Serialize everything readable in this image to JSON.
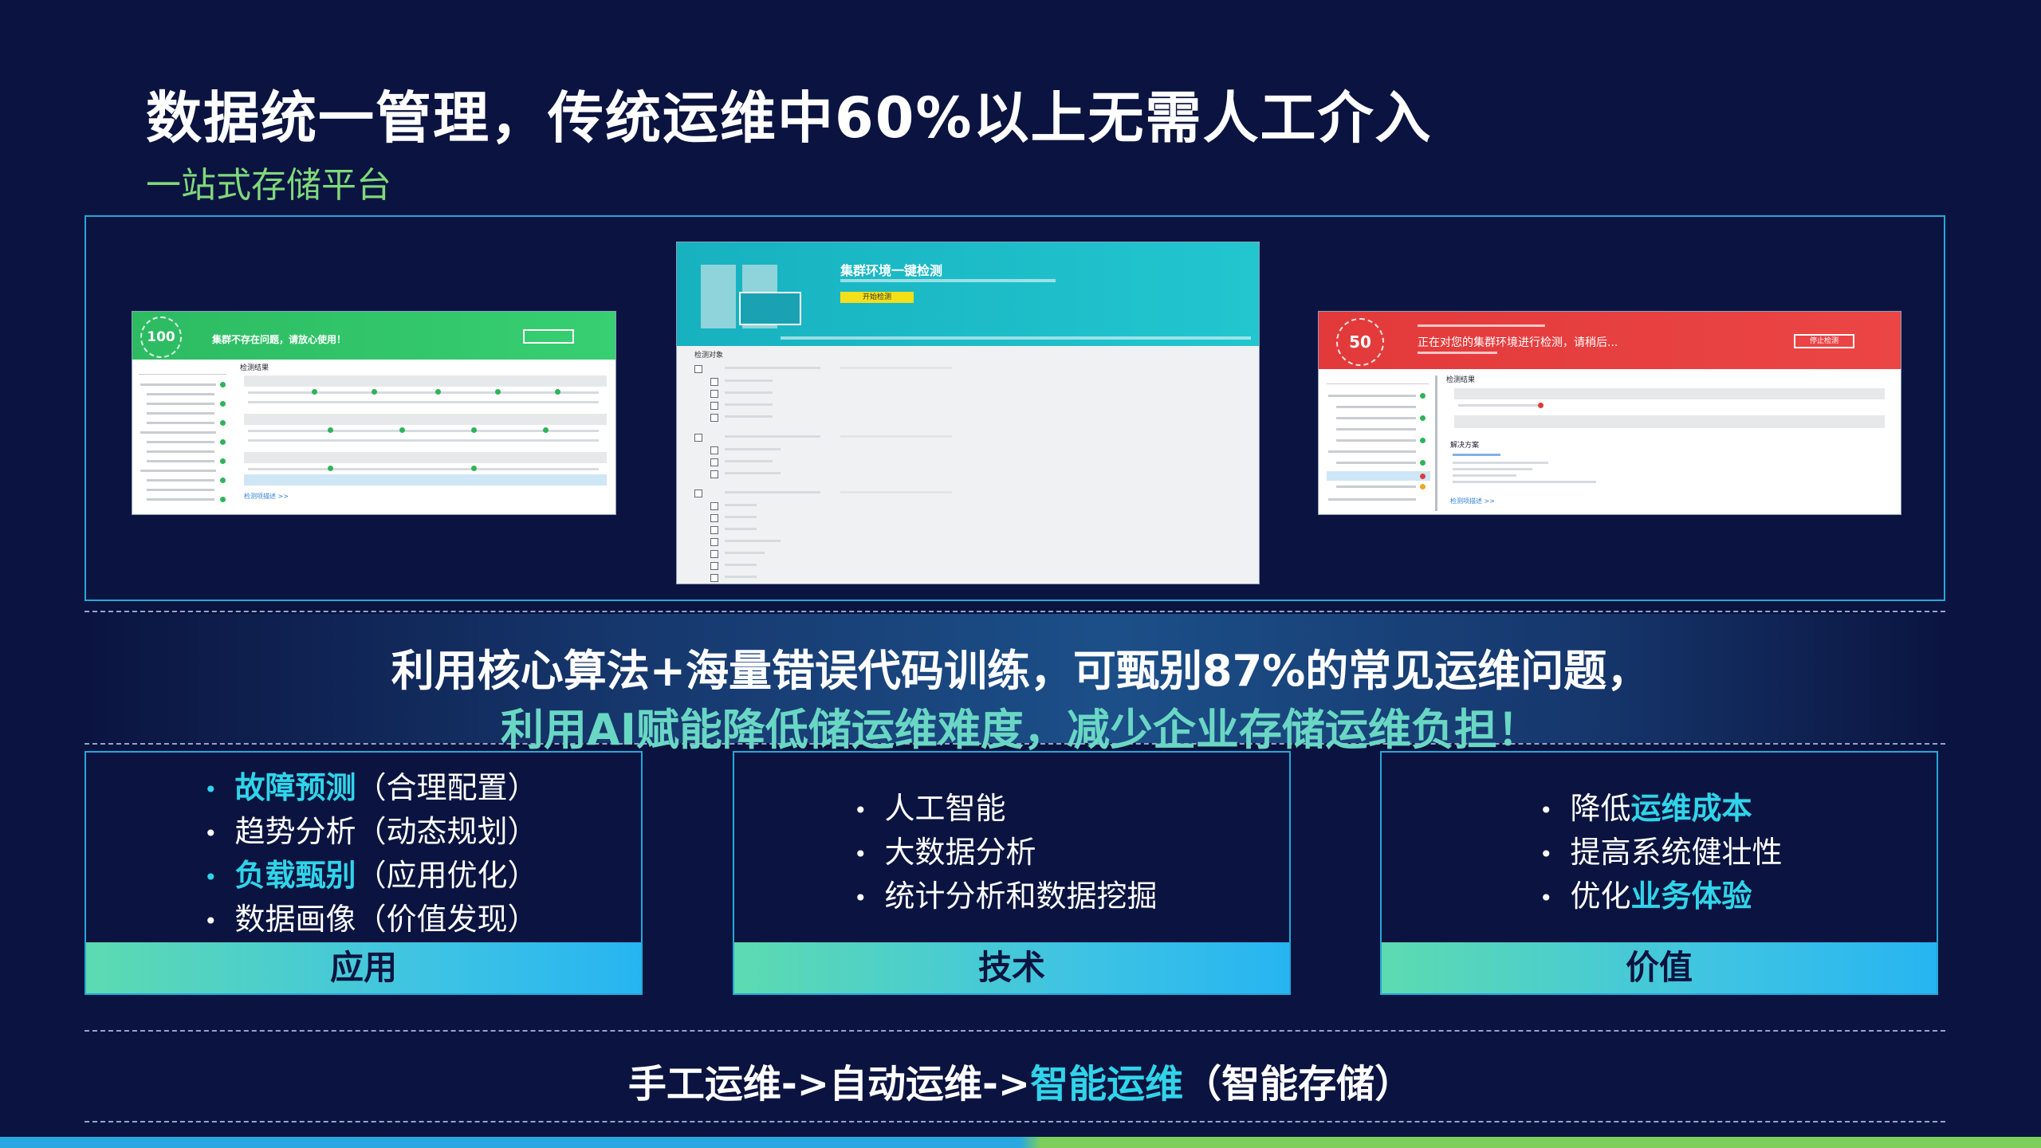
{
  "title": "数据统一管理，传统运维中60%以上无需人工介入",
  "subtitle": "一站式存储平台",
  "screens": {
    "left": {
      "score": "100",
      "message": "集群不存在问题，请放心使用！",
      "section": "检测结果",
      "link": "检测项描述 >>"
    },
    "center": {
      "title": "集群环境一键检测",
      "button": "开始检测",
      "section": "检测对象"
    },
    "right": {
      "score": "50",
      "message": "正在对您的集群环境进行检测，请稍后...",
      "button": "停止检测",
      "section": "检测结果",
      "solution": "解决方案",
      "link": "检测项描述 >>"
    }
  },
  "banner": {
    "line1": "利用核心算法+海量错误代码训练，可甄别87%的常见运维问题，",
    "line2": "利用AI赋能降低储运维难度，减少企业存储运维负担！"
  },
  "cards": {
    "app": {
      "label": "应用",
      "items": [
        {
          "hl": "故障预测",
          "rest": "（合理配置）"
        },
        {
          "hl": "",
          "rest": "趋势分析（动态规划）"
        },
        {
          "hl": "负载甄别",
          "rest": "（应用优化）"
        },
        {
          "hl": "",
          "rest": "数据画像（价值发现）"
        }
      ]
    },
    "tech": {
      "label": "技术",
      "items": [
        "人工智能",
        "大数据分析",
        "统计分析和数据挖掘"
      ]
    },
    "value": {
      "label": "价值",
      "items": [
        {
          "pre": "降低",
          "hl": "运维成本"
        },
        {
          "pre": "提高系统健壮性",
          "hl": ""
        },
        {
          "pre": "优化",
          "hl": "业务体验"
        }
      ]
    }
  },
  "bottom": {
    "prefix": "手工运维->自动运维->",
    "hl": "智能运维",
    "suffix": "（智能存储）"
  },
  "colors": {
    "background": "#0b1440",
    "highlight": "#30d4ea",
    "green": "#2fc36a",
    "teal": "#1fb7c4",
    "red": "#e23a3a",
    "frame": "#27a6d8"
  }
}
